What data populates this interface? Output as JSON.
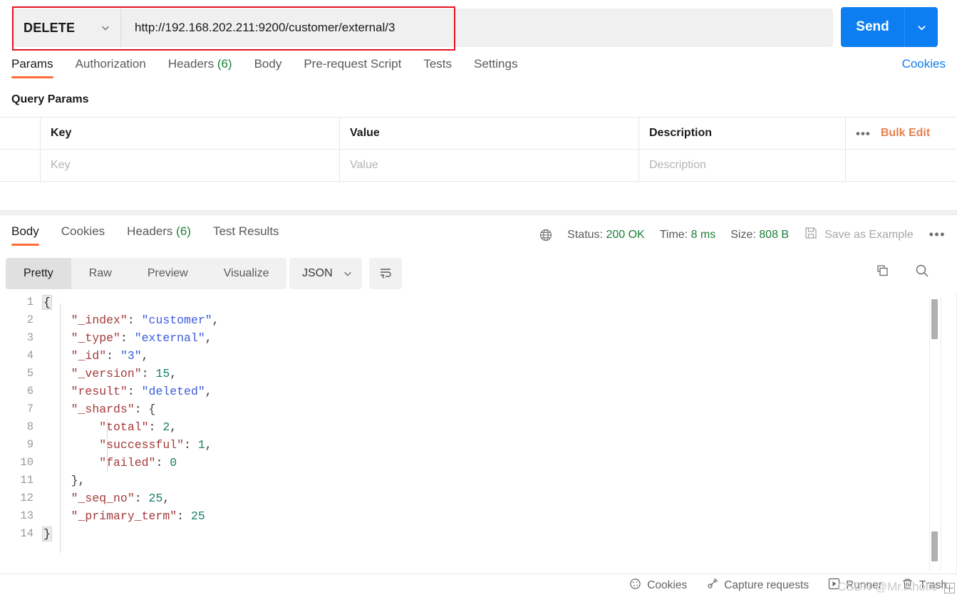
{
  "request": {
    "method": "DELETE",
    "url": "http://192.168.202.211:9200/customer/external/3",
    "send_label": "Send",
    "tabs": [
      {
        "label": "Params",
        "count": null,
        "active": true
      },
      {
        "label": "Authorization",
        "count": null,
        "active": false
      },
      {
        "label": "Headers",
        "count": "(6)",
        "active": false
      },
      {
        "label": "Body",
        "count": null,
        "active": false
      },
      {
        "label": "Pre-request Script",
        "count": null,
        "active": false
      },
      {
        "label": "Tests",
        "count": null,
        "active": false
      },
      {
        "label": "Settings",
        "count": null,
        "active": false
      }
    ],
    "cookies_link": "Cookies",
    "query_params_title": "Query Params",
    "params_table": {
      "headers": [
        "Key",
        "Value",
        "Description"
      ],
      "bulk_edit_label": "Bulk Edit",
      "rows": [
        {
          "key": "Key",
          "value": "Value",
          "description": "Description"
        }
      ]
    }
  },
  "response": {
    "tabs": [
      {
        "label": "Body",
        "count": null,
        "active": true
      },
      {
        "label": "Cookies",
        "count": null,
        "active": false
      },
      {
        "label": "Headers",
        "count": "(6)",
        "active": false
      },
      {
        "label": "Test Results",
        "count": null,
        "active": false
      }
    ],
    "meta": {
      "status_label": "Status:",
      "status_value": "200 OK",
      "time_label": "Time:",
      "time_value": "8 ms",
      "size_label": "Size:",
      "size_value": "808 B",
      "save_example_label": "Save as Example"
    },
    "format_tabs": [
      {
        "label": "Pretty",
        "active": true
      },
      {
        "label": "Raw",
        "active": false
      },
      {
        "label": "Preview",
        "active": false
      },
      {
        "label": "Visualize",
        "active": false
      }
    ],
    "language": "JSON",
    "body_lines": [
      {
        "n": "1",
        "segments": [
          {
            "t": "{",
            "c": "fold"
          }
        ]
      },
      {
        "n": "2",
        "segments": [
          {
            "t": "    ",
            "c": "pun"
          },
          {
            "t": "\"_index\"",
            "c": "key"
          },
          {
            "t": ": ",
            "c": "pun"
          },
          {
            "t": "\"customer\"",
            "c": "str"
          },
          {
            "t": ",",
            "c": "pun"
          }
        ]
      },
      {
        "n": "3",
        "segments": [
          {
            "t": "    ",
            "c": "pun"
          },
          {
            "t": "\"_type\"",
            "c": "key"
          },
          {
            "t": ": ",
            "c": "pun"
          },
          {
            "t": "\"external\"",
            "c": "str"
          },
          {
            "t": ",",
            "c": "pun"
          }
        ]
      },
      {
        "n": "4",
        "segments": [
          {
            "t": "    ",
            "c": "pun"
          },
          {
            "t": "\"_id\"",
            "c": "key"
          },
          {
            "t": ": ",
            "c": "pun"
          },
          {
            "t": "\"3\"",
            "c": "str"
          },
          {
            "t": ",",
            "c": "pun"
          }
        ]
      },
      {
        "n": "5",
        "segments": [
          {
            "t": "    ",
            "c": "pun"
          },
          {
            "t": "\"_version\"",
            "c": "key"
          },
          {
            "t": ": ",
            "c": "pun"
          },
          {
            "t": "15",
            "c": "num"
          },
          {
            "t": ",",
            "c": "pun"
          }
        ]
      },
      {
        "n": "6",
        "segments": [
          {
            "t": "    ",
            "c": "pun"
          },
          {
            "t": "\"result\"",
            "c": "key"
          },
          {
            "t": ": ",
            "c": "pun"
          },
          {
            "t": "\"deleted\"",
            "c": "str"
          },
          {
            "t": ",",
            "c": "pun"
          }
        ]
      },
      {
        "n": "7",
        "segments": [
          {
            "t": "    ",
            "c": "pun"
          },
          {
            "t": "\"_shards\"",
            "c": "key"
          },
          {
            "t": ": ",
            "c": "pun"
          },
          {
            "t": "{",
            "c": "pun"
          }
        ]
      },
      {
        "n": "8",
        "segments": [
          {
            "t": "        ",
            "c": "pun"
          },
          {
            "t": "\"total\"",
            "c": "key"
          },
          {
            "t": ": ",
            "c": "pun"
          },
          {
            "t": "2",
            "c": "num"
          },
          {
            "t": ",",
            "c": "pun"
          }
        ]
      },
      {
        "n": "9",
        "segments": [
          {
            "t": "        ",
            "c": "pun"
          },
          {
            "t": "\"successful\"",
            "c": "key"
          },
          {
            "t": ": ",
            "c": "pun"
          },
          {
            "t": "1",
            "c": "num"
          },
          {
            "t": ",",
            "c": "pun"
          }
        ]
      },
      {
        "n": "10",
        "segments": [
          {
            "t": "        ",
            "c": "pun"
          },
          {
            "t": "\"failed\"",
            "c": "key"
          },
          {
            "t": ": ",
            "c": "pun"
          },
          {
            "t": "0",
            "c": "num"
          }
        ]
      },
      {
        "n": "11",
        "segments": [
          {
            "t": "    ",
            "c": "pun"
          },
          {
            "t": "}",
            "c": "pun"
          },
          {
            "t": ",",
            "c": "pun"
          }
        ]
      },
      {
        "n": "12",
        "segments": [
          {
            "t": "    ",
            "c": "pun"
          },
          {
            "t": "\"_seq_no\"",
            "c": "key"
          },
          {
            "t": ": ",
            "c": "pun"
          },
          {
            "t": "25",
            "c": "num"
          },
          {
            "t": ",",
            "c": "pun"
          }
        ]
      },
      {
        "n": "13",
        "segments": [
          {
            "t": "    ",
            "c": "pun"
          },
          {
            "t": "\"_primary_term\"",
            "c": "key"
          },
          {
            "t": ": ",
            "c": "pun"
          },
          {
            "t": "25",
            "c": "num"
          }
        ]
      },
      {
        "n": "14",
        "segments": [
          {
            "t": "}",
            "c": "fold"
          }
        ]
      }
    ]
  },
  "status_bar": {
    "items": [
      "Cookies",
      "Capture requests",
      "Runner",
      "Trash"
    ],
    "watermark": "CSDN @Mr.Aholic"
  },
  "colors": {
    "accent_orange": "#ff6c37",
    "brand_blue": "#0d7ef2",
    "status_green": "#1a7f37",
    "highlight_red": "#e81123"
  }
}
